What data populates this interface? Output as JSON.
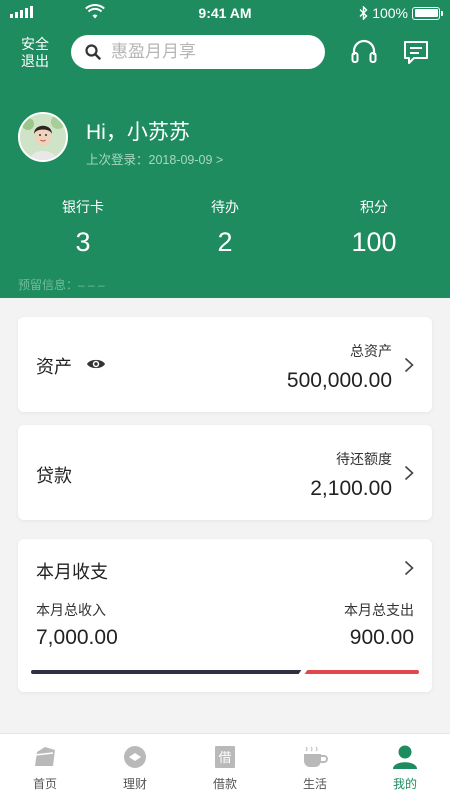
{
  "status": {
    "time": "9:41 AM",
    "battery": "100%"
  },
  "header": {
    "logout_label": "安全退出",
    "search_placeholder": "惠盈月月享",
    "greeting": "Hi，小苏苏",
    "last_login": "上次登录：2018-09-09 >",
    "stats": [
      {
        "label": "银行卡",
        "value": "3"
      },
      {
        "label": "待办",
        "value": "2"
      },
      {
        "label": "积分",
        "value": "100"
      }
    ],
    "reserved_info": "预留信息：– – –"
  },
  "assets": {
    "title": "资产",
    "total_label": "总资产",
    "total_value": "500,000.00"
  },
  "loan": {
    "title": "贷款",
    "due_label": "待还额度",
    "due_value": "2,100.00"
  },
  "monthly": {
    "title": "本月收支",
    "income_label": "本月总收入",
    "income_value": "7,000.00",
    "expense_label": "本月总支出",
    "expense_value": "900.00",
    "income_share": 0.7,
    "expense_share": 0.3
  },
  "tabs": [
    {
      "label": "首页",
      "icon": "home-icon"
    },
    {
      "label": "理财",
      "icon": "wealth-icon"
    },
    {
      "label": "借款",
      "icon": "borrow-icon"
    },
    {
      "label": "生活",
      "icon": "coffee-icon"
    },
    {
      "label": "我的",
      "icon": "user-icon"
    }
  ],
  "colors": {
    "brand": "#1f8c60",
    "income_bar": "#2d3142",
    "expense_bar": "#e0484c"
  }
}
